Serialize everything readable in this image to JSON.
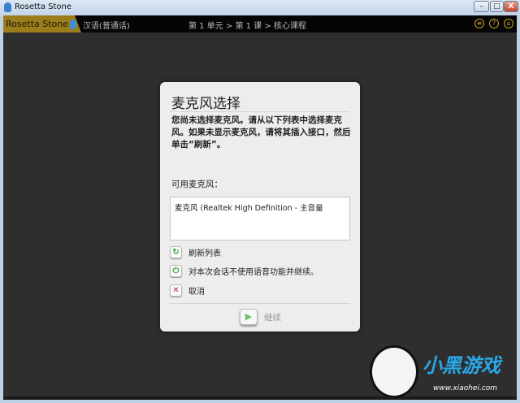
{
  "window": {
    "title": "Rosetta Stone",
    "minimize": "–",
    "maximize": "□",
    "close": "X"
  },
  "header": {
    "logo": "Rosetta Stone",
    "language": "汉语(普通话)",
    "breadcrumb": "第 1 单元 > 第 1 课 > 核心课程",
    "icons": [
      "notes-icon",
      "help-icon",
      "home-icon"
    ]
  },
  "dialog": {
    "title": "麦克风选择",
    "message": "您尚未选择麦克风。请从以下列表中选择麦克风。如果未显示麦克风，请将其插入接口，然后单击“刷新”。",
    "list_label": "可用麦克风：",
    "microphones": [
      "麦克风 (Realtek High Definition - 主音量"
    ],
    "options": [
      {
        "label": "刷新列表",
        "icon": "refresh-icon",
        "color": "#2f9e2f"
      },
      {
        "label": "对本次会话不使用语音功能并继续。",
        "icon": "mic-off-icon",
        "color": "#2f9e2f"
      },
      {
        "label": "取消",
        "icon": "close-icon",
        "color": "#d02020"
      }
    ],
    "continue": "继续"
  },
  "watermark": {
    "text": "小黑游戏",
    "url": "www.xiaohei.com"
  }
}
